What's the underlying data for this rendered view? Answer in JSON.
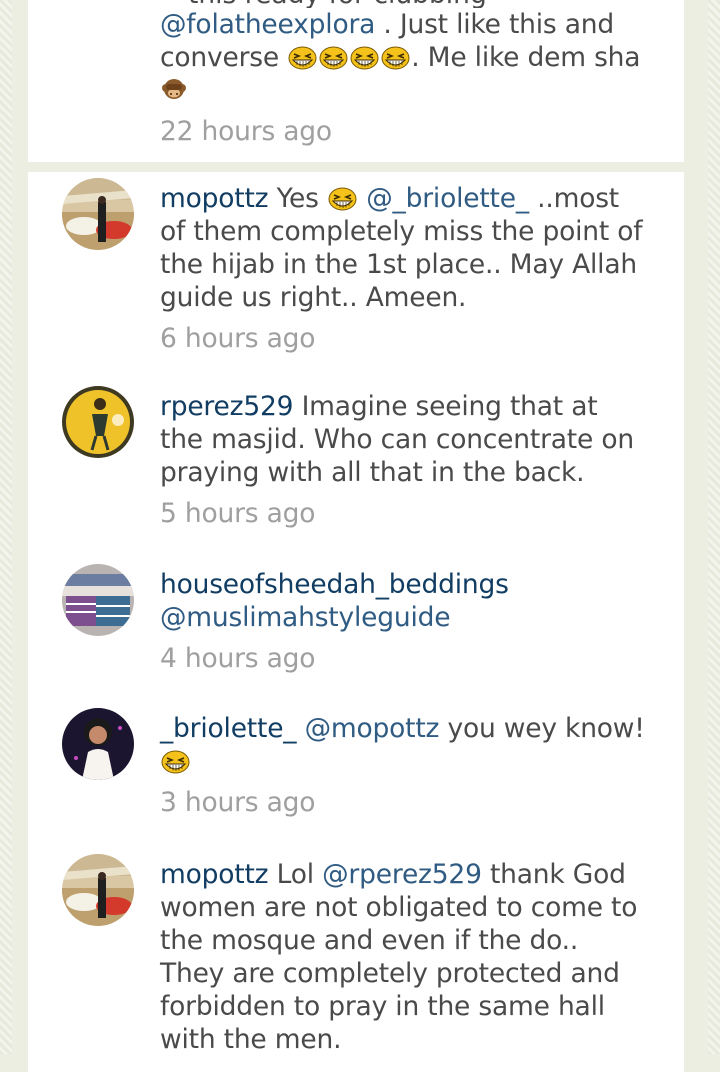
{
  "top_comment": {
    "partial_first_line": "this",
    "partial_ready": "ready for clubbing",
    "mention": "@folatheexplora",
    "text_after_mention": " . Just like this and converse",
    "after_emoji": ". Me like dem sha",
    "time": "22 hours ago"
  },
  "comments": [
    {
      "username": "mopottz",
      "prefix": "Yes",
      "mention": "@_briolette_",
      "text": " ..most of them completely miss the point of the hijab in the 1st place.. May Allah guide us right.. Ameen.",
      "time": "6 hours ago"
    },
    {
      "username": "rperez529",
      "text": "Imagine seeing that at the masjid. Who can concentrate on praying with all that in the back.",
      "time": "5 hours ago"
    },
    {
      "username": "houseofsheedah_beddings",
      "mention": "@muslimahstyleguide",
      "time": "4 hours ago"
    },
    {
      "username": "_briolette_",
      "mention": "@mopottz",
      "text": " you wey know!",
      "time": "3 hours ago"
    },
    {
      "username": "mopottz",
      "prefix": "Lol",
      "mention": "@rperez529",
      "text": " thank God women are not obligated to come to the mosque and even if the do.. They are completely protected and forbidden to pray in the same hall with the men."
    }
  ],
  "icons": {
    "laugh": "grinning-squint-emoji-icon",
    "monkey": "see-no-evil-monkey-icon"
  },
  "colors": {
    "username": "#123d63",
    "mention": "#305b82",
    "text": "#4a4a4a",
    "time": "#9f9f9f",
    "background": "#eceee2"
  }
}
